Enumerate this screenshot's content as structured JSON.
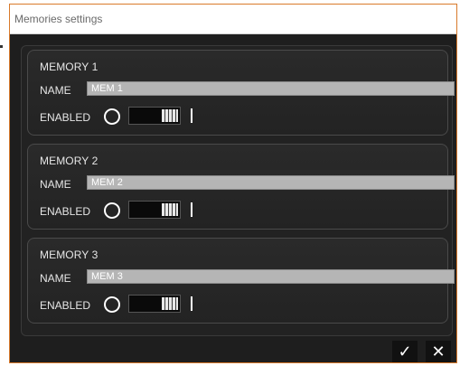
{
  "window": {
    "title": "Memories settings"
  },
  "memories": [
    {
      "title": "MEMORY 1",
      "name_label": "NAME",
      "name_value": "MEM 1",
      "enabled_label": "ENABLED"
    },
    {
      "title": "MEMORY 2",
      "name_label": "NAME",
      "name_value": "MEM 2",
      "enabled_label": "ENABLED"
    },
    {
      "title": "MEMORY 3",
      "name_label": "NAME",
      "name_value": "MEM 3",
      "enabled_label": "ENABLED"
    }
  ],
  "buttons": {
    "ok_icon": "✓",
    "cancel_icon": "✕"
  },
  "colors": {
    "accent_border": "#d97a2b",
    "dialog_bg": "#1e1e1e",
    "input_bg": "#b5b5b5"
  }
}
